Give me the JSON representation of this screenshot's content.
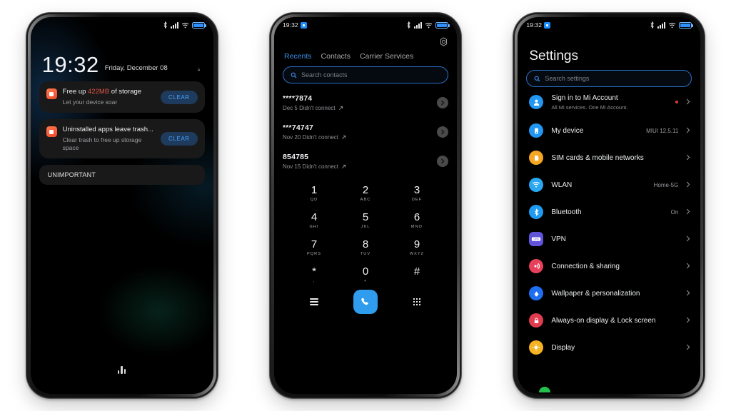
{
  "statusbar": {
    "time": "19:32",
    "icons": [
      "bluetooth-icon",
      "signal-icon",
      "wifi-icon",
      "battery-icon"
    ]
  },
  "phone1": {
    "name": "lock-screen-notifications",
    "clock": "19:32",
    "date": "Friday, December 08",
    "bell_icon": "bell-icon",
    "notifications": [
      {
        "title_prefix": "Free up ",
        "amount": "422MB",
        "title_suffix": " of storage",
        "body": "Let your device soar",
        "action": "CLEAR",
        "icon": "cleaner-app-icon"
      },
      {
        "title_prefix": "Uninstalled apps leave trash...",
        "amount": "",
        "title_suffix": "",
        "body": "Clear trash to free up storage space",
        "action": "CLEAR",
        "icon": "cleaner-app-icon"
      }
    ],
    "section_header": "UNIMPORTANT",
    "music_indicator": "audio-bars-icon"
  },
  "phone2": {
    "name": "dialer-recents",
    "gear_icon": "gear-icon",
    "tabs": [
      {
        "label": "Recents",
        "active": true
      },
      {
        "label": "Contacts",
        "active": false
      },
      {
        "label": "Carrier Services",
        "active": false
      }
    ],
    "search": {
      "placeholder": "Search contacts",
      "icon": "search-icon"
    },
    "calls": [
      {
        "number": "****7874",
        "meta": "Dec 5 Didn't connect",
        "direction_icon": "outgoing-call-arrow-icon"
      },
      {
        "number": "***74747",
        "meta": "Nov 20 Didn't connect",
        "direction_icon": "outgoing-call-arrow-icon"
      },
      {
        "number": "854785",
        "meta": "Nov 15 Didn't connect",
        "direction_icon": "outgoing-call-arrow-icon"
      }
    ],
    "keypad": [
      [
        {
          "digit": "1",
          "letters": "QD"
        },
        {
          "digit": "2",
          "letters": "ABC"
        },
        {
          "digit": "3",
          "letters": "DEF"
        }
      ],
      [
        {
          "digit": "4",
          "letters": "GHI"
        },
        {
          "digit": "5",
          "letters": "JKL"
        },
        {
          "digit": "6",
          "letters": "MNO"
        }
      ],
      [
        {
          "digit": "7",
          "letters": "PQRS"
        },
        {
          "digit": "8",
          "letters": "TUV"
        },
        {
          "digit": "9",
          "letters": "WXYZ"
        }
      ],
      [
        {
          "digit": "*",
          "letters": ","
        },
        {
          "digit": "0",
          "letters": "+"
        },
        {
          "digit": "#",
          "letters": ""
        }
      ]
    ],
    "actions": {
      "menu_icon": "hamburger-menu-icon",
      "call_icon": "phone-handset-icon",
      "dialpad_icon": "dialpad-grid-icon",
      "call_button_color": "#2f9ced"
    }
  },
  "phone3": {
    "name": "settings-list",
    "title": "Settings",
    "search": {
      "placeholder": "Search settings",
      "icon": "search-icon"
    },
    "items": [
      {
        "label": "Sign in to Mi Account",
        "sub": "All Mi services. One Mi Account.",
        "value": "",
        "icon": "account-icon",
        "color": "#2196f3",
        "badge": true
      },
      {
        "label": "My device",
        "sub": "",
        "value": "MIUI 12.5.11",
        "icon": "device-icon",
        "color": "#2196f3",
        "badge": false
      },
      {
        "label": "SIM cards & mobile networks",
        "sub": "",
        "value": "",
        "icon": "sim-card-icon",
        "color": "#f5a623",
        "badge": false
      },
      {
        "label": "WLAN",
        "sub": "",
        "value": "Home-5G",
        "icon": "wifi-icon",
        "color": "#29a7f0",
        "badge": false
      },
      {
        "label": "Bluetooth",
        "sub": "",
        "value": "On",
        "icon": "bluetooth-icon",
        "color": "#1e9bf0",
        "badge": false
      },
      {
        "label": "VPN",
        "sub": "",
        "value": "",
        "icon": "vpn-icon",
        "color": "#6254d8",
        "badge": false
      },
      {
        "label": "Connection & sharing",
        "sub": "",
        "value": "",
        "icon": "connection-sharing-icon",
        "color": "#e8405a",
        "badge": false
      },
      {
        "label": "Wallpaper & personalization",
        "sub": "",
        "value": "",
        "icon": "wallpaper-icon",
        "color": "#1f6df0",
        "badge": false
      },
      {
        "label": "Always-on display & Lock screen",
        "sub": "",
        "value": "",
        "icon": "lock-icon",
        "color": "#e03b4e",
        "badge": false
      },
      {
        "label": "Display",
        "sub": "",
        "value": "",
        "icon": "brightness-icon",
        "color": "#f5b324",
        "badge": false
      }
    ]
  }
}
